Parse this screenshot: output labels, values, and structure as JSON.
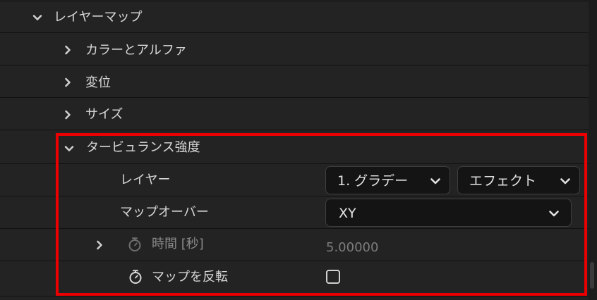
{
  "layer_map": {
    "label": "レイヤーマップ",
    "items": [
      {
        "label": "カラーとアルファ"
      },
      {
        "label": "変位"
      },
      {
        "label": "サイズ"
      }
    ],
    "turbulence": {
      "label": "タービュランス強度",
      "layer_row": {
        "label": "レイヤー",
        "source_value": "1. グラデー",
        "type_value": "エフェクト"
      },
      "map_over_row": {
        "label": "マップオーバー",
        "value": "XY"
      },
      "time_row": {
        "label": "時間 [秒]",
        "value": "5.00000"
      },
      "invert_row": {
        "label": "マップを反転",
        "checked": false
      }
    }
  },
  "colors": {
    "highlight": "#ea0000",
    "background": "#232323"
  },
  "icons": {
    "expanded": "chevron-down-icon",
    "collapsed": "chevron-right-icon",
    "keyframe": "stopwatch-icon"
  }
}
